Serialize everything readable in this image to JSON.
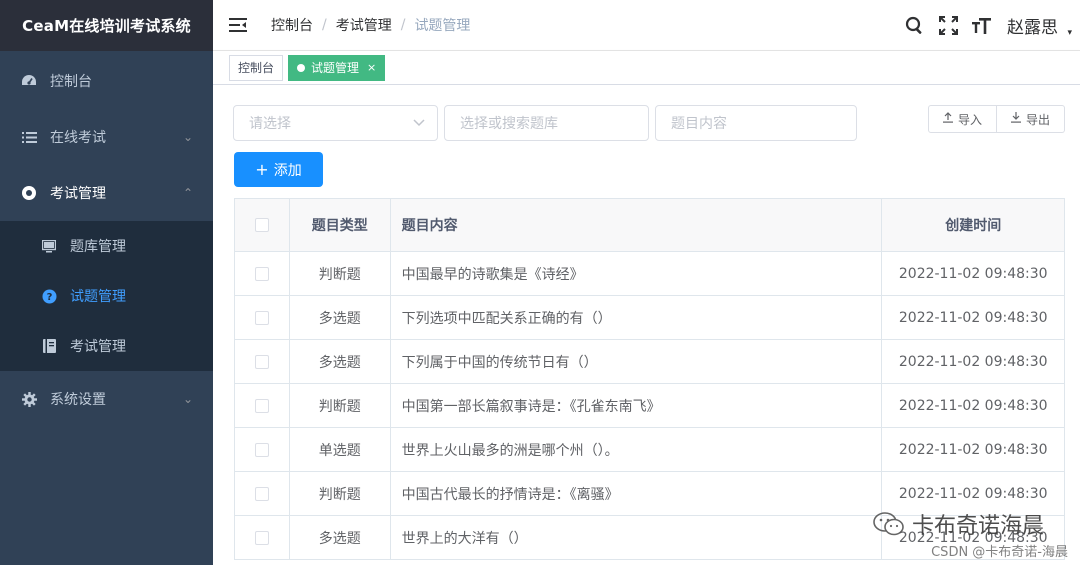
{
  "app": {
    "title": "CeaM在线培训考试系统"
  },
  "sidebar": {
    "items": [
      {
        "label": "控制台",
        "icon": "dashboard-icon"
      },
      {
        "label": "在线考试",
        "icon": "list-icon",
        "arrow": "⌄"
      },
      {
        "label": "考试管理",
        "icon": "lifebuoy-icon",
        "arrow": "⌃"
      },
      {
        "label": "系统设置",
        "icon": "gear-icon",
        "arrow": "⌄"
      }
    ],
    "submenu": [
      {
        "label": "题库管理",
        "icon": "monitor-icon"
      },
      {
        "label": "试题管理",
        "icon": "question-circle-icon",
        "active": true
      },
      {
        "label": "考试管理",
        "icon": "book-icon"
      }
    ]
  },
  "header": {
    "breadcrumb": [
      "控制台",
      "考试管理",
      "试题管理"
    ],
    "separator": "/",
    "username": "赵露思",
    "caret": "▾"
  },
  "tags": [
    {
      "label": "控制台"
    },
    {
      "label": "试题管理",
      "close": "×",
      "active": true
    }
  ],
  "filters": {
    "type_placeholder": "请选择",
    "repo_placeholder": "选择或搜索题库",
    "content_placeholder": "题目内容"
  },
  "toolbar": {
    "import_label": "导入",
    "export_label": "导出",
    "add_label": "添加",
    "add_icon": "+"
  },
  "table": {
    "headers": {
      "type": "题目类型",
      "content": "题目内容",
      "time": "创建时间"
    },
    "rows": [
      {
        "type": "判断题",
        "content": "中国最早的诗歌集是《诗经》",
        "time": "2022-11-02 09:48:30"
      },
      {
        "type": "多选题",
        "content": "下列选项中匹配关系正确的有（）",
        "time": "2022-11-02 09:48:30"
      },
      {
        "type": "多选题",
        "content": "下列属于中国的传统节日有（）",
        "time": "2022-11-02 09:48:30"
      },
      {
        "type": "判断题",
        "content": "中国第一部长篇叙事诗是：《孔雀东南飞》",
        "time": "2022-11-02 09:48:30"
      },
      {
        "type": "单选题",
        "content": "世界上火山最多的洲是哪个州（）。",
        "time": "2022-11-02 09:48:30"
      },
      {
        "type": "判断题",
        "content": "中国古代最长的抒情诗是：《离骚》",
        "time": "2022-11-02 09:48:30"
      },
      {
        "type": "多选题",
        "content": "世界上的大洋有（）",
        "time": "2022-11-02 09:48:30"
      }
    ]
  },
  "watermark": {
    "text": "卡布奇诺海晨",
    "csdn": "CSDN @卡布奇诺-海晨"
  },
  "colors": {
    "sidebar": "#304156",
    "submenu": "#1f2d3d",
    "primary": "#1890ff",
    "tag_active": "#42b983",
    "active_text": "#409eff"
  }
}
